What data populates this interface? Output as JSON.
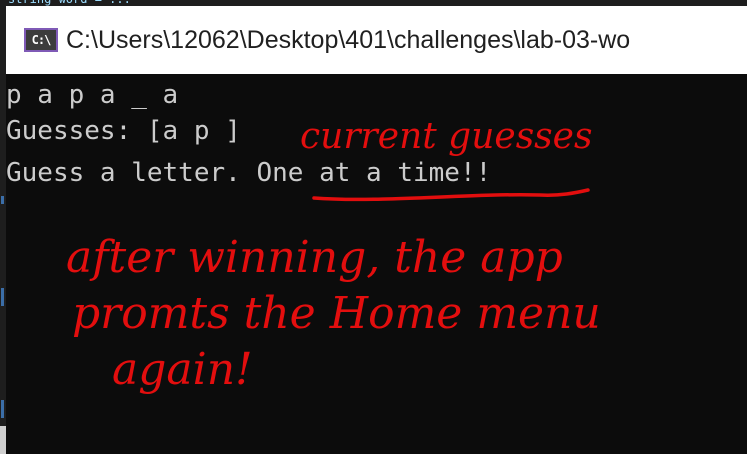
{
  "window": {
    "title": "C:\\Users\\12062\\Desktop\\401\\challenges\\lab-03-wo",
    "icon": "cmd-prompt-icon",
    "icon_text": "C:\\"
  },
  "console": {
    "lines": [
      "p a p a _ a",
      "Guesses: [a p ]",
      "Guess a letter. One at a time!!"
    ]
  },
  "annotations": {
    "label_1": "current guesses",
    "note_line_1": "after winning, the app",
    "note_line_2": "promts the Home menu",
    "note_line_3": "again!"
  },
  "colors": {
    "console_bg": "#0c0c0c",
    "console_text": "#cccccc",
    "titlebar_bg": "#ffffff",
    "annotation_ink": "#e30e0e"
  }
}
